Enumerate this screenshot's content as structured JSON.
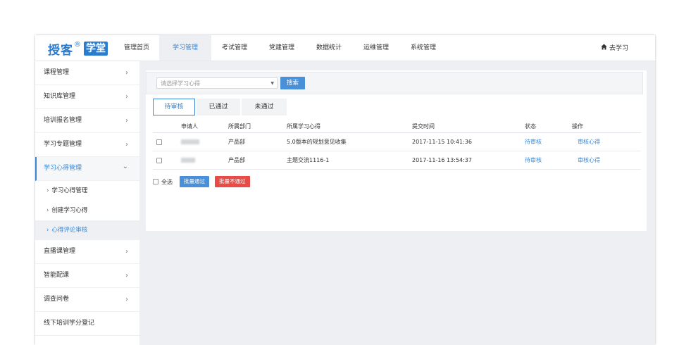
{
  "logo": {
    "main": "授客",
    "reg": "®",
    "box": "学堂"
  },
  "nav": [
    {
      "label": "管理首页"
    },
    {
      "label": "学习管理",
      "active": true
    },
    {
      "label": "考试管理"
    },
    {
      "label": "党建管理"
    },
    {
      "label": "数据统计"
    },
    {
      "label": "运维管理"
    },
    {
      "label": "系统管理"
    }
  ],
  "go_study": "去学习",
  "sidebar": {
    "items": [
      {
        "label": "课程管理",
        "chevron": "›"
      },
      {
        "label": "知识库管理",
        "chevron": "›"
      },
      {
        "label": "培训报名管理",
        "chevron": "›"
      },
      {
        "label": "学习专题管理",
        "chevron": "›"
      },
      {
        "label": "学习心得管理",
        "chevron": "⌄"
      },
      {
        "label": "直播课管理",
        "chevron": "›"
      },
      {
        "label": "智能配课",
        "chevron": "›"
      },
      {
        "label": "调查问卷",
        "chevron": "›"
      },
      {
        "label": "线下培训学分登记"
      }
    ],
    "subitems": [
      {
        "label": "学习心得管理",
        "arrow": "›"
      },
      {
        "label": "创建学习心得",
        "arrow": "›"
      },
      {
        "label": "心得评论审核",
        "arrow": "›"
      }
    ]
  },
  "search": {
    "placeholder": "请选择学习心得",
    "button": "搜索",
    "caret": "▼"
  },
  "tabs": [
    {
      "label": "待审核"
    },
    {
      "label": "已通过"
    },
    {
      "label": "未通过"
    }
  ],
  "table": {
    "headers": [
      "申请人",
      "所属部门",
      "所属学习心得",
      "提交时间",
      "状态",
      "操作"
    ],
    "rows": [
      {
        "department": "产品部",
        "topic": "5.0版本的规划意见收集",
        "time": "2017-11-15 10:41:36",
        "status": "待审核",
        "action": "审核心得"
      },
      {
        "department": "产品部",
        "topic": "主题交流1116-1",
        "time": "2017-11-16 13:54:37",
        "status": "待审核",
        "action": "审核心得"
      }
    ]
  },
  "footer": {
    "select_all": "全选",
    "batch_pass": "批量通过",
    "batch_fail": "批量不通过"
  },
  "colors": {
    "accent": "#3a86d2",
    "danger": "#e94b46",
    "button": "#4a90d9"
  }
}
